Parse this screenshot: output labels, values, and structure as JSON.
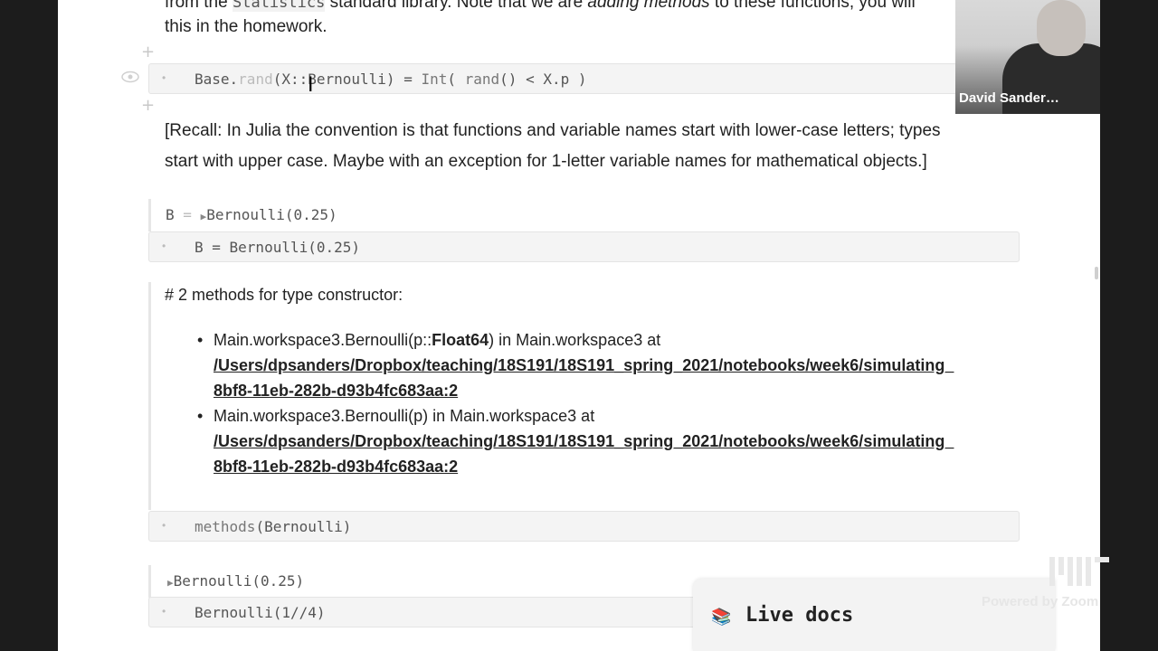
{
  "top_text": {
    "line1_prefix": "from the",
    "line1_code": "Statistics",
    "line1_mid": "standard library. Note that we are",
    "line1_em": "adding methods",
    "line1_suffix": "to these functions; you will",
    "line2": "this in the homework."
  },
  "cell_rand": {
    "code_parts": [
      "Base.",
      "rand",
      "(X::Bernoulli) = ",
      "Int",
      "( ",
      "rand",
      "() < X.p )"
    ]
  },
  "recall": {
    "line1": "[Recall: In Julia the convention is that functions and variable names start with lower-case letters; types",
    "line2": "start with upper case. Maybe with an exception for 1-letter variable names for mathematical objects.]"
  },
  "cell_B": {
    "output_lhs": "B",
    "output_eq": "=",
    "output_value": "Bernoulli(0.25)",
    "input_code": "B = Bernoulli(0.25)"
  },
  "methods_output": {
    "heading": "# 2 methods for type constructor:",
    "items": [
      {
        "sig_prefix": "Main.workspace3.Bernoulli(p::",
        "sig_type": "Float64",
        "sig_suffix": ") in Main.workspace3 at",
        "path_line1": "/Users/dpsanders/Dropbox/teaching/18S191/18S191_spring_2021/notebooks/week6/simulating_",
        "path_line2": "8bf8-11eb-282b-d93b4fc683aa:2"
      },
      {
        "sig_prefix": "Main.workspace3.Bernoulli(p) in Main.workspace3 at",
        "sig_type": "",
        "sig_suffix": "",
        "path_line1": "/Users/dpsanders/Dropbox/teaching/18S191/18S191_spring_2021/notebooks/week6/simulating_",
        "path_line2": "8bf8-11eb-282b-d93b4fc683aa:2"
      }
    ],
    "input_code_fn": "methods",
    "input_code_arg": "(Bernoulli)"
  },
  "cell_last": {
    "output_value": "Bernoulli(0.25)",
    "input_code": "Bernoulli(1//4)"
  },
  "webcam": {
    "name": "David Sander…"
  },
  "live_docs": {
    "icon": "books-icon",
    "label": "Live docs"
  },
  "zoom_watermark": "Powered by Zoom",
  "colors": {
    "page_bg": "#ffffff",
    "code_bg": "#f4f4f4",
    "frame_bg": "#1c1c1c"
  }
}
